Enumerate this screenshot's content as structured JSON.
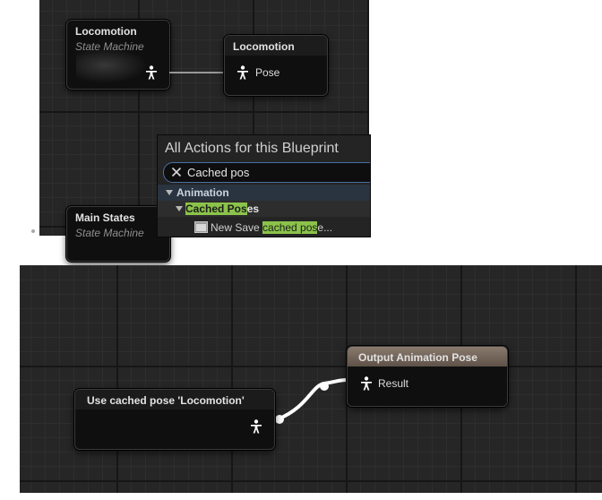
{
  "top_graph": {
    "locomotion_state_machine": {
      "title": "Locomotion",
      "subtitle": "State Machine"
    },
    "locomotion_cached": {
      "title": "Locomotion",
      "pin_label": "Pose"
    },
    "main_states": {
      "title": "Main States",
      "subtitle": "State Machine"
    }
  },
  "action_menu": {
    "title": "All Actions for this Blueprint",
    "search_value": "Cached pos",
    "category": "Animation",
    "subcategory_match": "Cached Pos",
    "subcategory_rest": "es",
    "item_prefix": "New Save ",
    "item_match": "cached pos",
    "item_rest": "e..."
  },
  "bottom_graph": {
    "use_cached_pose": {
      "title": "Use cached pose 'Locomotion'"
    },
    "output_animation_pose": {
      "title": "Output Animation Pose",
      "pin_label": "Result"
    }
  },
  "colors": {
    "graph_bg": "#262626",
    "node_bg": "#0f0f0f",
    "output_header": "#7a6a5e",
    "search_highlight": "#8bc34a",
    "wire": "#ffffff"
  },
  "icons": [
    "pose-pin-icon",
    "clear-search-icon",
    "expand-triangle-icon",
    "function-item-icon"
  ]
}
